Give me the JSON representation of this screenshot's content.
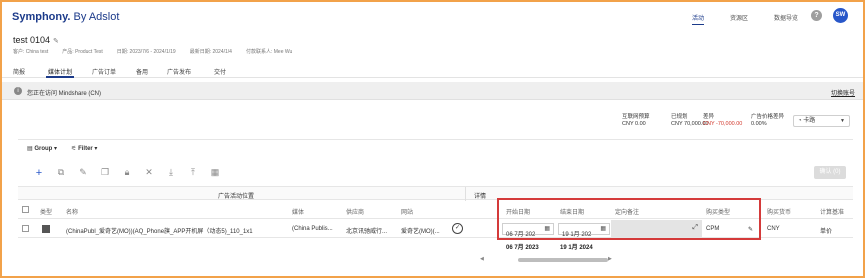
{
  "brand": {
    "name": "Symphony.",
    "suffix": " By Adslot"
  },
  "topnav": [
    "活动",
    "资源区",
    "数据导览"
  ],
  "help_label": "?",
  "user_initials": "SW",
  "campaign": {
    "title": "test 0104",
    "meta": [
      "客户: China test",
      "产品: Product Test",
      "日期: 2023/7/6 - 2024/1/19",
      "最新日期: 2024/1/4",
      "付款联系人: Mee Wu"
    ]
  },
  "tabs": [
    "简报",
    "媒体计划",
    "广告订单",
    "备用",
    "广告发布",
    "交付"
  ],
  "notice": {
    "text": "您正在访问 Mindshare (CN)",
    "link": "切换账号"
  },
  "stats": [
    {
      "label": "互联网预算",
      "value": "CNY 0.00",
      "red": false
    },
    {
      "label": "已规划",
      "value": "CNY 70,000.00",
      "red": false
    },
    {
      "label": "差异",
      "value": "CNY -70,000.00",
      "red": true
    },
    {
      "label": "广告价格差异",
      "value": "0.00%",
      "red": false
    }
  ],
  "picker": {
    "value": "卡路"
  },
  "toolbar": {
    "group": "Group",
    "filter": "Filter",
    "confirm": "确认 (0)"
  },
  "groups": {
    "left": "广告活动位置",
    "right": "详情"
  },
  "columns": [
    "类型",
    "名称",
    "媒体",
    "供应商",
    "网站",
    "开始日期",
    "结束日期",
    "定向备注",
    "购买类型",
    "购买货币",
    "计算基准"
  ],
  "row": {
    "name": "(ChinaPubl_爱奇艺(MO))(AQ_Phone旗_APP开机屏（动态5)_110_1x1",
    "media": "(China Publis...",
    "vendor": "北京讯驰威行...",
    "site": "爱奇艺(MO)(...",
    "start": "06 7月 202",
    "end": "19 1月 202",
    "buy_type": "CPM",
    "currency": "CNY",
    "basis": "单价"
  },
  "subrow": {
    "start": "06 7月 2023",
    "end": "19 1月 2024"
  }
}
